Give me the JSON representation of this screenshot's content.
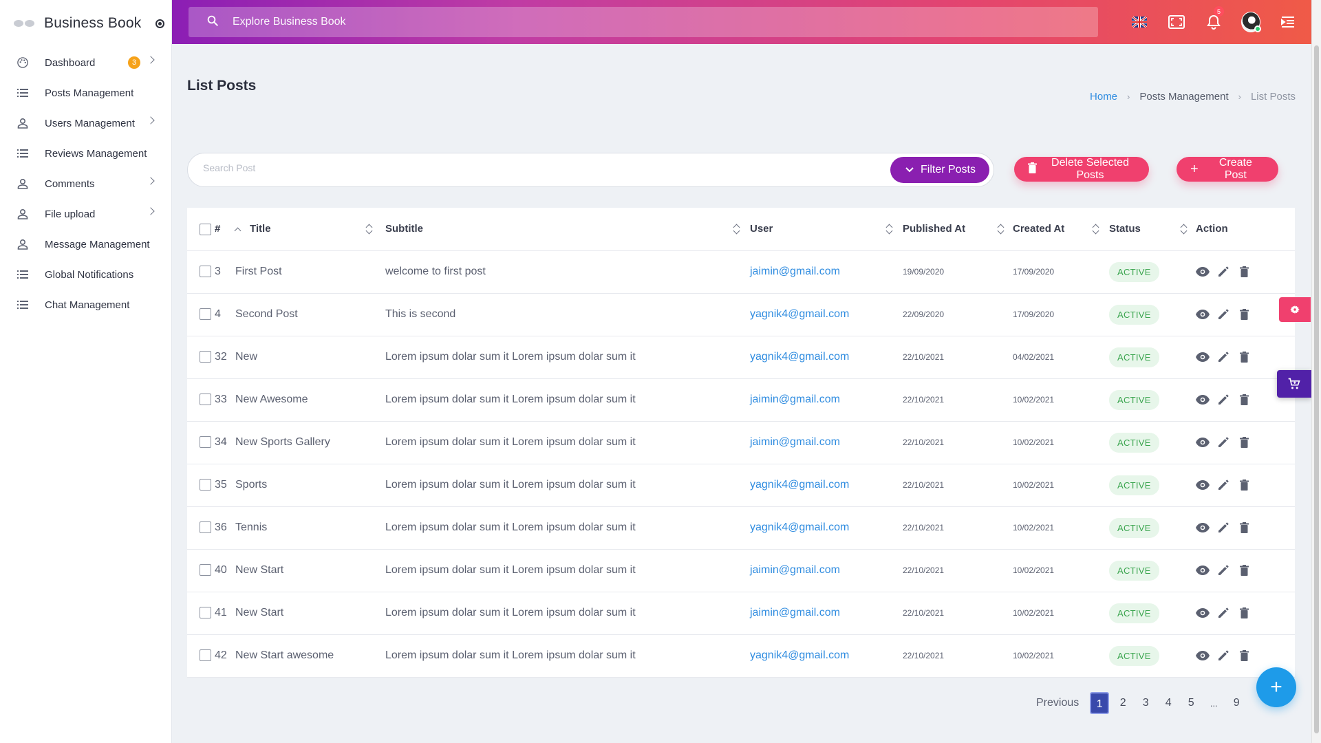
{
  "app": {
    "brand_name": "Business Book",
    "search_placeholder": "Explore Business Book",
    "notification_count": "5"
  },
  "sidebar": {
    "items": [
      {
        "label": "Dashboard",
        "icon": "palette-icon",
        "badge": "3",
        "has_submenu": true
      },
      {
        "label": "Posts Management",
        "icon": "list-icon",
        "has_submenu": false
      },
      {
        "label": "Users Management",
        "icon": "user-icon",
        "has_submenu": true
      },
      {
        "label": "Reviews Management",
        "icon": "list-icon",
        "has_submenu": false
      },
      {
        "label": "Comments",
        "icon": "user-icon",
        "has_submenu": true
      },
      {
        "label": "File upload",
        "icon": "user-icon",
        "has_submenu": true
      },
      {
        "label": "Message Management",
        "icon": "user-icon",
        "has_submenu": false
      },
      {
        "label": "Global Notifications",
        "icon": "list-icon",
        "has_submenu": false
      },
      {
        "label": "Chat Management",
        "icon": "list-icon",
        "has_submenu": false
      }
    ]
  },
  "page": {
    "title": "List Posts",
    "breadcrumb": [
      "Home",
      "Posts Management",
      "List Posts"
    ]
  },
  "toolbar": {
    "search_placeholder": "Search Post",
    "filter_label": "Filter Posts",
    "delete_label": "Delete Selected Posts",
    "create_label": "Create Post"
  },
  "table": {
    "headers": [
      "#",
      "Title",
      "Subtitle",
      "User",
      "Published At",
      "Created At",
      "Status",
      "Action"
    ],
    "rows": [
      {
        "id": "3",
        "title": "First Post",
        "subtitle": "welcome to first post",
        "user": "jaimin@gmail.com",
        "published": "19/09/2020",
        "created": "17/09/2020",
        "status": "ACTIVE"
      },
      {
        "id": "4",
        "title": "Second Post",
        "subtitle": "This is second",
        "user": "yagnik4@gmail.com",
        "published": "22/09/2020",
        "created": "17/09/2020",
        "status": "ACTIVE"
      },
      {
        "id": "32",
        "title": "New",
        "subtitle": "Lorem ipsum dolar sum it Lorem ipsum dolar sum it",
        "user": "yagnik4@gmail.com",
        "published": "22/10/2021",
        "created": "04/02/2021",
        "status": "ACTIVE"
      },
      {
        "id": "33",
        "title": "New Awesome",
        "subtitle": "Lorem ipsum dolar sum it Lorem ipsum dolar sum it",
        "user": "jaimin@gmail.com",
        "published": "22/10/2021",
        "created": "10/02/2021",
        "status": "ACTIVE"
      },
      {
        "id": "34",
        "title": "New Sports Gallery",
        "subtitle": "Lorem ipsum dolar sum it Lorem ipsum dolar sum it",
        "user": "jaimin@gmail.com",
        "published": "22/10/2021",
        "created": "10/02/2021",
        "status": "ACTIVE"
      },
      {
        "id": "35",
        "title": "Sports",
        "subtitle": "Lorem ipsum dolar sum it Lorem ipsum dolar sum it",
        "user": "yagnik4@gmail.com",
        "published": "22/10/2021",
        "created": "10/02/2021",
        "status": "ACTIVE"
      },
      {
        "id": "36",
        "title": "Tennis",
        "subtitle": "Lorem ipsum dolar sum it Lorem ipsum dolar sum it",
        "user": "yagnik4@gmail.com",
        "published": "22/10/2021",
        "created": "10/02/2021",
        "status": "ACTIVE"
      },
      {
        "id": "40",
        "title": "New Start",
        "subtitle": "Lorem ipsum dolar sum it Lorem ipsum dolar sum it",
        "user": "jaimin@gmail.com",
        "published": "22/10/2021",
        "created": "10/02/2021",
        "status": "ACTIVE"
      },
      {
        "id": "41",
        "title": "New Start",
        "subtitle": "Lorem ipsum dolar sum it Lorem ipsum dolar sum it",
        "user": "jaimin@gmail.com",
        "published": "22/10/2021",
        "created": "10/02/2021",
        "status": "ACTIVE"
      },
      {
        "id": "42",
        "title": "New Start awesome",
        "subtitle": "Lorem ipsum dolar sum it Lorem ipsum dolar sum it",
        "user": "yagnik4@gmail.com",
        "published": "22/10/2021",
        "created": "10/02/2021",
        "status": "ACTIVE"
      }
    ]
  },
  "pagination": {
    "previous_label": "Previous",
    "pages": [
      "1",
      "2",
      "3",
      "4",
      "5",
      "...",
      "9"
    ],
    "current": "1"
  },
  "colors": {
    "topbar_gradient": [
      "#8b1eb4",
      "#c03ca4",
      "#e4456e",
      "#f05b46"
    ],
    "accent_pink": "#f0406e",
    "filter_purple": "#8a1fb0",
    "link_blue": "#2f8ce0",
    "status_green": "#3ba54f",
    "pagination_active": "#3949ab",
    "fab_blue": "#1e9be9"
  }
}
